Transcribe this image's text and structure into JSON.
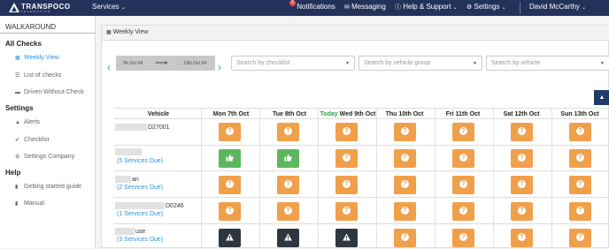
{
  "topbar": {
    "brand": "TRANSPOCO",
    "brand_sub": "TELEMATICS",
    "services": "Services",
    "notifications": "Notifications",
    "notif_count": "6",
    "messaging": "Messaging",
    "help": "Help & Support",
    "settings": "Settings",
    "user": "David McCarthy"
  },
  "sidebar": {
    "title": "WALKAROUND",
    "sections": {
      "all_checks": "All Checks",
      "settings": "Settings",
      "help": "Help"
    },
    "items": {
      "weekly_view": "Weekly View",
      "list_of_checks": "List of checks",
      "driven_without_check": "Driven Without Check",
      "alerts": "Alerts",
      "checklist": "Checklist",
      "settings_company": "Settings Company",
      "getting_started": "Getting started guide",
      "manual": "Manual"
    }
  },
  "main": {
    "view_title": "Weekly View",
    "date_from": "7th Oct 24",
    "date_to": "13th Oct 24",
    "checklist_placeholder": "Search by checklist",
    "vehicle_group_placeholder": "Search by vehicle group",
    "vehicle_placeholder": "Search by vehicle"
  },
  "table": {
    "vehicle_header": "Vehicle",
    "today_label": "Today",
    "days": [
      "Mon 7th Oct",
      "Tue 8th Oct",
      "Wed 9th Oct",
      "Thu 10th Oct",
      "Fri 11th Oct",
      "Sat 12th Oct",
      "Sun 13th Oct"
    ],
    "rows": [
      {
        "name": "D27001",
        "services": "",
        "cells": [
          "orange",
          "orange",
          "orange",
          "orange",
          "orange",
          "orange",
          "orange"
        ]
      },
      {
        "name": "",
        "services": "(5 Services Due)",
        "cells": [
          "green",
          "green",
          "orange",
          "orange",
          "orange",
          "orange",
          "orange"
        ]
      },
      {
        "name": "an",
        "services": "(2 Services Due)",
        "cells": [
          "orange",
          "orange",
          "orange",
          "orange",
          "orange",
          "orange",
          "orange"
        ]
      },
      {
        "name": "D0246",
        "services": "(1 Services Due)",
        "cells": [
          "orange",
          "orange",
          "orange",
          "orange",
          "orange",
          "orange",
          "orange"
        ]
      },
      {
        "name": "use",
        "services": "(3 Services Due)",
        "cells": [
          "dark",
          "dark",
          "dark",
          "orange",
          "orange",
          "orange",
          "orange"
        ]
      }
    ]
  },
  "colors": {
    "navbar": "#23325a",
    "accent_blue": "#2d93d7",
    "status_orange": "#f0a04b",
    "status_green": "#5cb85c",
    "status_dark": "#2e3640",
    "today_green": "#2aa34a"
  },
  "icons": {
    "unknown": "question-icon",
    "passed": "thumbs-up-icon",
    "defect": "warning-icon"
  }
}
